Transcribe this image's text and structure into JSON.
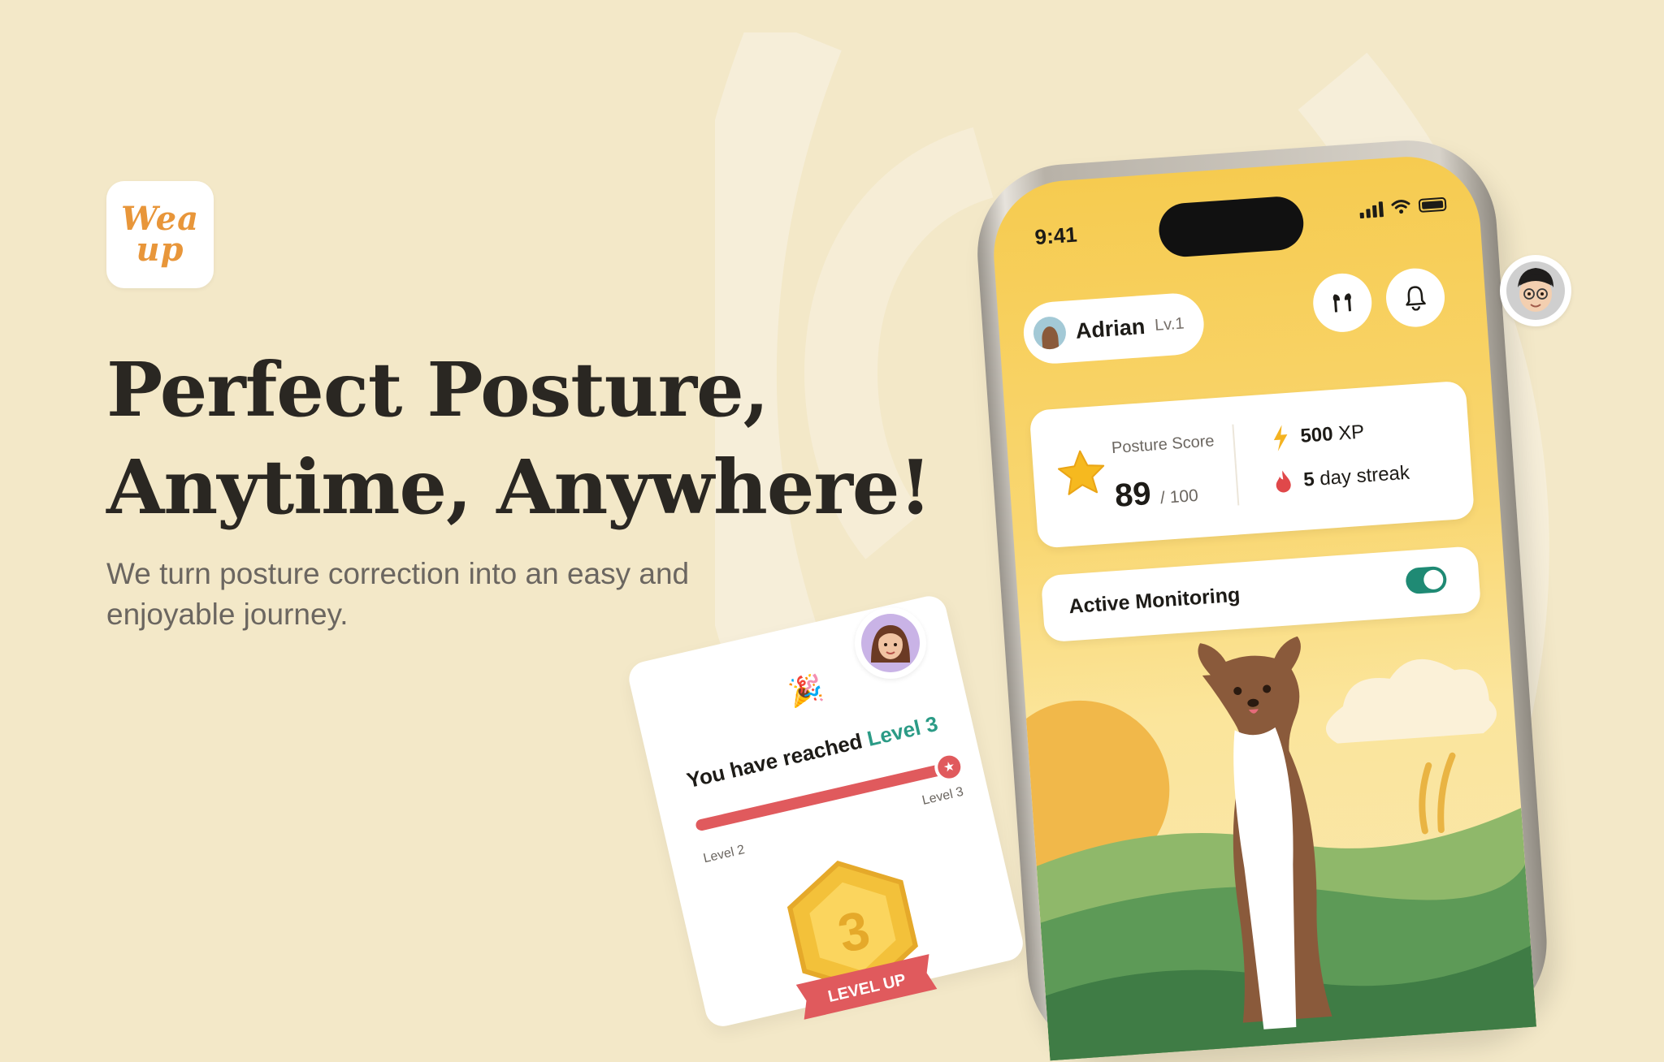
{
  "brand": {
    "logo_line1": "Wea",
    "logo_line2": "up"
  },
  "hero": {
    "headline_line1": "Perfect Posture,",
    "headline_line2": "Anytime, Anywhere!",
    "subtext": "We turn posture correction into an easy and enjoyable journey."
  },
  "phone": {
    "status": {
      "time": "9:41"
    },
    "user": {
      "name": "Adrian",
      "level": "Lv.1"
    },
    "stats": {
      "score_label": "Posture Score",
      "score_value": "89",
      "score_max": "/ 100",
      "xp_value": "500",
      "xp_unit": "XP",
      "streak_value": "5",
      "streak_unit": "day streak"
    },
    "monitoring": {
      "label": "Active Monitoring",
      "enabled": true
    }
  },
  "level_card": {
    "reached_text": "You have reached",
    "reached_level": "Level 3",
    "from_label": "Level 2",
    "to_label": "Level 3",
    "progress": 1.0,
    "badge_number": "3",
    "badge_label": "LEVEL UP"
  },
  "icons": {
    "earbuds": "earbuds-icon",
    "bell": "bell-icon",
    "star": "star-icon",
    "lightning": "lightning-icon",
    "flame": "flame-icon",
    "party": "party-popper-icon"
  },
  "colors": {
    "background": "#f3e8c8",
    "accent_orange": "#e8963a",
    "teal": "#1f8a74",
    "progress_red": "#e05a5d",
    "phone_yellow": "#f6cb50"
  }
}
